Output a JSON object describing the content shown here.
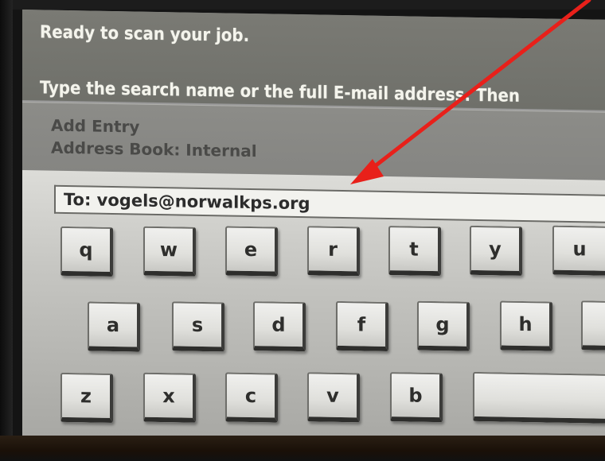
{
  "status": {
    "line1": "Ready to scan your job.",
    "line2": "Type the search name or the full E-mail address. Then"
  },
  "entry": {
    "title": "Add Entry",
    "address_book": "Address Book: Internal"
  },
  "to_field": {
    "value": "To: vogels@norwalkps.org"
  },
  "keyboard": {
    "row1": [
      "q",
      "w",
      "e",
      "r",
      "t",
      "y",
      "u"
    ],
    "row2": [
      "a",
      "s",
      "d",
      "f",
      "g",
      "h",
      ""
    ],
    "row3": [
      "z",
      "x",
      "c",
      "v",
      "b",
      ""
    ]
  },
  "annotation": {
    "arrow_color": "#e8201a"
  }
}
